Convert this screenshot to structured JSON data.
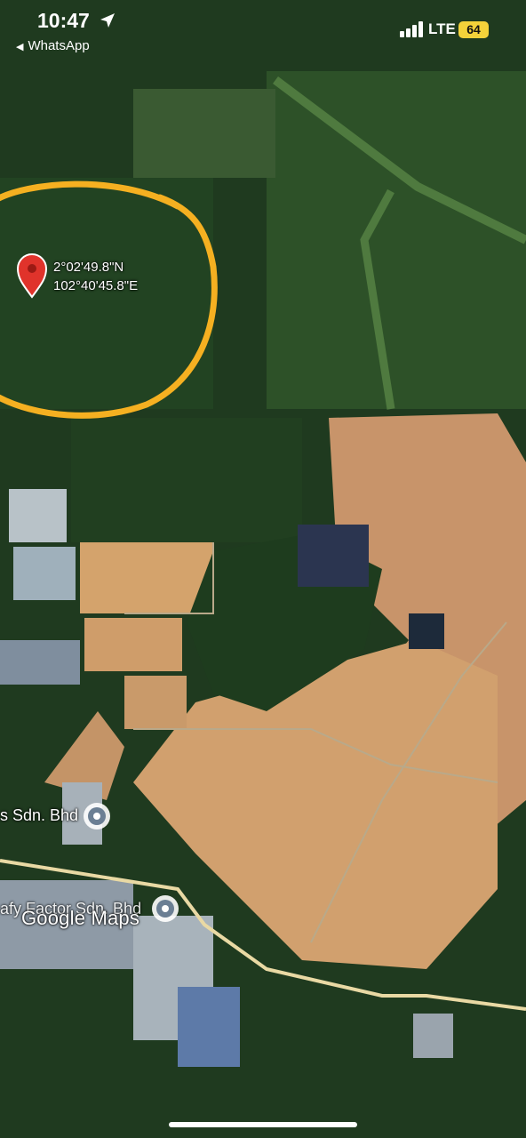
{
  "status_bar": {
    "time": "10:47",
    "back_app": "WhatsApp",
    "network": "LTE",
    "battery": "64"
  },
  "pin": {
    "lat": "2°02'49.8\"N",
    "lng": "102°40'45.8\"E"
  },
  "places": [
    {
      "label": "s Sdn. Bhd",
      "icon": "place-marker-icon"
    },
    {
      "label": "afy Factor Sdn. Bhd",
      "icon": "place-marker-icon"
    }
  ],
  "watermark": "Google Maps",
  "colors": {
    "forest": "#1f3a1f",
    "plantation": "#2e5a2a",
    "cleared_land": "#d4a36c",
    "road": "#e9d9a4",
    "highlight_circle": "#f5b021",
    "pin": "#e0332b"
  }
}
